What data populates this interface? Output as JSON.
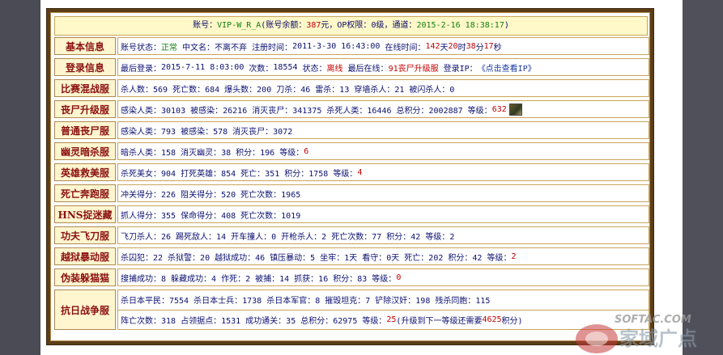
{
  "header": {
    "account_label": "账号：",
    "account": "VIP-W_R_A",
    "balance_label": "(账号余额：",
    "balance": "387",
    "balance_unit": "元，OP权限：",
    "op": "0级",
    "channel_label": "，通道：",
    "channel_time": "2015-2-16 18:38:17",
    "close": ")"
  },
  "rows": {
    "basic": {
      "label": "基本信息",
      "status_label": "账号状态：",
      "status": "正常",
      "cn_label": "中文名：",
      "cn": "不离不弃",
      "reg_label": "注册时间：",
      "reg": "2011-3-30 16:43:00",
      "online_label": "在线时间：",
      "online_d": "142",
      "d_unit": "天",
      "online_h": "20",
      "h_unit": "时",
      "online_m": "38",
      "m_unit": "分",
      "online_s": "17",
      "s_unit": "秒"
    },
    "login": {
      "label": "登录信息",
      "last_label": "最后登录：",
      "last": "2015-7-11 8:03:00",
      "count_label": "次数：",
      "count": "18554",
      "state_label": "状态：",
      "state": "离线",
      "lastonline_label": "最后在线：",
      "lastonline": "91丧尸升级服",
      "ip_label": "登录IP：",
      "ip": "《点击查看IP》"
    },
    "mixed": {
      "label": "比赛混战服",
      "text": "杀人数：569 死亡数：684 爆头数：200 刀杀：46 雷杀：13 穿墙杀人：21 被闪杀人：0"
    },
    "zombie": {
      "label": "丧尸升级服",
      "text": "感染人类：30103 被感染：26216 消灭丧尸：341375 杀死人类：16446 总积分：2002887 等级：",
      "level": "632"
    },
    "normalzombie": {
      "label": "普通丧尸服",
      "text": "感染人类：793 被感染：578 消灭丧尸：3072"
    },
    "ghost": {
      "label": "幽灵暗杀服",
      "text": "暗杀人类：158 消灭幽灵：38 积分：196 等级：",
      "level": "6"
    },
    "hero": {
      "label": "英雄救美服",
      "text": "杀死美女：904 打死英雄：854 死亡：351 积分：1758 等级：",
      "level": "4"
    },
    "deathrun": {
      "label": "死亡奔跑服",
      "text": "冲关得分：226 阻关得分：520 死亡次数：1965"
    },
    "hns": {
      "label": "HNS捉迷藏",
      "text": "抓人得分：355 保命得分：408 死亡次数：1019"
    },
    "kungfu": {
      "label": "功夫飞刀服",
      "text": "飞刀杀人：26 踢死敌人：14 开车撞人：0 开枪杀人：2 死亡次数：77 积分：42 等级：2"
    },
    "jailbreak": {
      "label": "越狱暴动服",
      "text": "杀囚犯：22 杀狱警：20 越狱成功：46 镇压暴动：5 坐牢：1天 看守：0天 死亡：202 积分：42 等级：",
      "level": "2"
    },
    "disguise": {
      "label": "伪装躲猫猫",
      "text": "搜捕成功：8 躲藏成功：4 作死：2 被捕：14 抓获：16 积分：83 等级：",
      "level": "0"
    },
    "war": {
      "label": "抗日战争服",
      "line1": "杀日本平民：7554 杀日本士兵：1738 杀日本军官：8 摧毁坦克：7 铲除汉奸：198 残杀同胞：115",
      "line2a": "阵亡次数：318 占领据点：1531 成功通关：35 总积分：62975 等级：",
      "level": "25",
      "line2b": " (升级到下一等级还需要",
      "need": "4625",
      "line2c": "积分)"
    }
  },
  "watermark": {
    "text_top": "SOFTAC.COM",
    "text_main": "家域广点"
  },
  "colors": {
    "frame": "#5b3d17",
    "label_bg": "#fff6d0",
    "label_text": "#8b1010",
    "header_bg": "#fff8c8",
    "red": "#c40000",
    "green": "#108010"
  }
}
